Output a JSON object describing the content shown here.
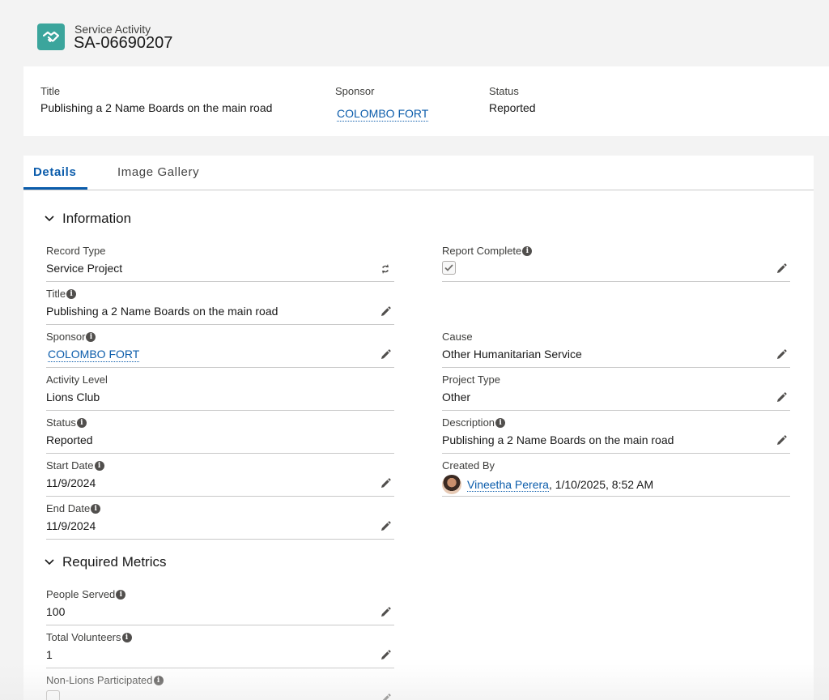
{
  "header": {
    "object_label": "Service Activity",
    "record_name": "SA-06690207",
    "icon": "handshake-icon"
  },
  "highlights": {
    "title_label": "Title",
    "title_value": "Publishing a 2 Name Boards on the main road",
    "sponsor_label": "Sponsor",
    "sponsor_value": "COLOMBO FORT",
    "status_label": "Status",
    "status_value": "Reported"
  },
  "tabs": [
    {
      "label": "Details",
      "active": true
    },
    {
      "label": "Image Gallery",
      "active": false
    }
  ],
  "sections": {
    "information": "Information",
    "required_metrics": "Required Metrics"
  },
  "fields": {
    "record_type": {
      "label": "Record Type",
      "value": "Service Project"
    },
    "title": {
      "label": "Title",
      "value": "Publishing a 2 Name Boards on the main road"
    },
    "sponsor": {
      "label": "Sponsor",
      "value": "COLOMBO FORT"
    },
    "activity_level": {
      "label": "Activity Level",
      "value": "Lions Club"
    },
    "status": {
      "label": "Status",
      "value": "Reported"
    },
    "start_date": {
      "label": "Start Date",
      "value": "11/9/2024"
    },
    "end_date": {
      "label": "End Date",
      "value": "11/9/2024"
    },
    "report_complete": {
      "label": "Report Complete",
      "checked": true
    },
    "cause": {
      "label": "Cause",
      "value": "Other Humanitarian Service"
    },
    "project_type": {
      "label": "Project Type",
      "value": "Other"
    },
    "description": {
      "label": "Description",
      "value": "Publishing a 2 Name Boards on the main road"
    },
    "created_by": {
      "label": "Created By",
      "user": "Vineetha Perera",
      "timestamp": ", 1/10/2025, 8:52 AM"
    },
    "people_served": {
      "label": "People Served",
      "value": "100"
    },
    "total_volunteers": {
      "label": "Total Volunteers",
      "value": "1"
    },
    "non_lions_participated": {
      "label": "Non-Lions Participated",
      "checked": false
    }
  },
  "colors": {
    "brand": "#0b5cab",
    "icon_bg": "#3ba59c"
  }
}
